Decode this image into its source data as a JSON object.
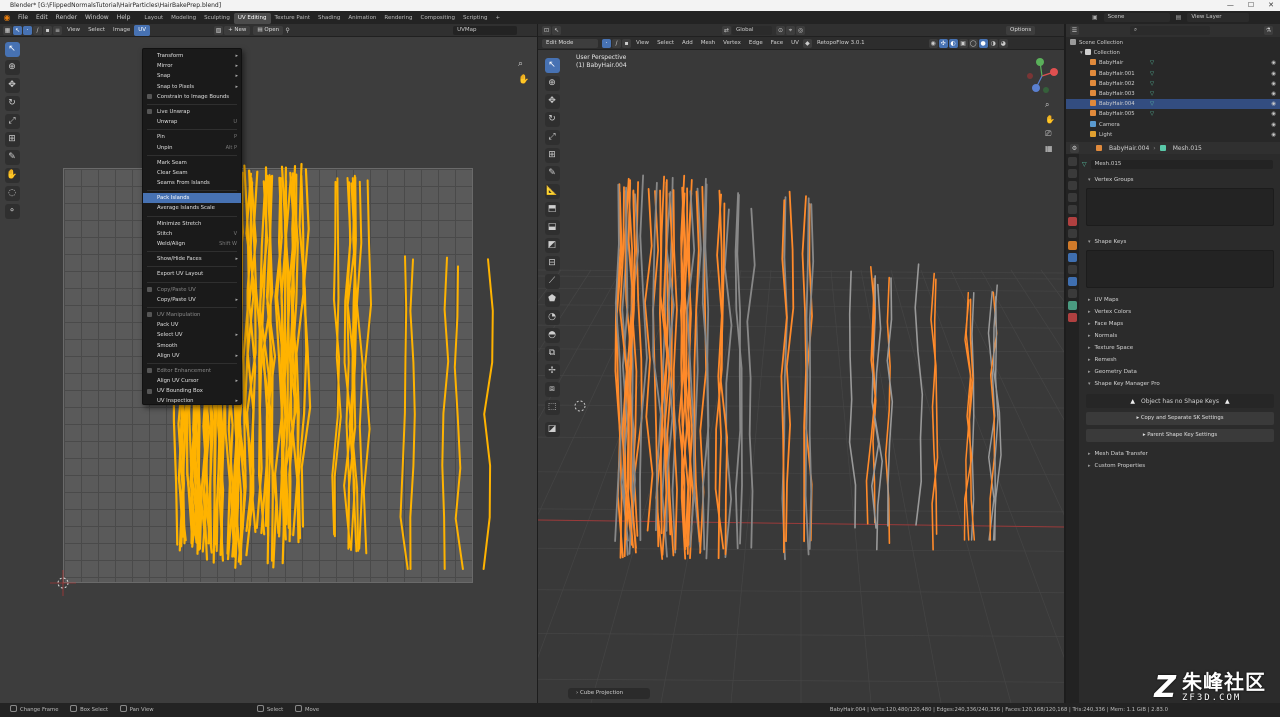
{
  "window": {
    "title": "Blender* [G:\\FlippedNormalsTutorial\\HairParticles\\HairBakePrep.blend]",
    "controls": [
      "—",
      "☐",
      "✕"
    ]
  },
  "topbar": {
    "menus": [
      "File",
      "Edit",
      "Render",
      "Window",
      "Help"
    ],
    "workspaces": [
      "Layout",
      "Modeling",
      "Sculpting",
      "UV Editing",
      "Texture Paint",
      "Shading",
      "Animation",
      "Rendering",
      "Compositing",
      "Scripting"
    ],
    "active_workspace": "UV Editing",
    "add_tab": "+",
    "scene_label": "Scene",
    "view_layer_label": "View Layer"
  },
  "uv_editor": {
    "header_menus": [
      "View",
      "Select",
      "Image",
      "UV"
    ],
    "new_label": "New",
    "open_label": "Open",
    "uvmap_field": "UVMap",
    "uv_color": "#ffb300"
  },
  "uv_menu": {
    "items": [
      {
        "label": "Transform",
        "submenu": true
      },
      {
        "label": "Mirror",
        "submenu": true
      },
      {
        "label": "Snap",
        "submenu": true
      },
      {
        "label": "Snap to Pixels",
        "submenu": true
      },
      {
        "label": "Constrain to Image Bounds",
        "check": true
      },
      {
        "sep": true
      },
      {
        "label": "Live Unwrap",
        "check": true
      },
      {
        "label": "Unwrap",
        "shortcut": "U"
      },
      {
        "sep": true
      },
      {
        "label": "Pin",
        "shortcut": "P"
      },
      {
        "label": "Unpin",
        "shortcut": "Alt P"
      },
      {
        "sep": true
      },
      {
        "label": "Mark Seam"
      },
      {
        "label": "Clear Seam"
      },
      {
        "label": "Seams From Islands"
      },
      {
        "sep": true
      },
      {
        "label": "Pack Islands",
        "highlight": true
      },
      {
        "label": "Average Islands Scale"
      },
      {
        "sep": true
      },
      {
        "label": "Minimize Stretch"
      },
      {
        "label": "Stitch",
        "shortcut": "V"
      },
      {
        "label": "Weld/Align",
        "shortcut": "Shift W"
      },
      {
        "sep": true
      },
      {
        "label": "Show/Hide Faces",
        "submenu": true
      },
      {
        "sep": true
      },
      {
        "label": "Export UV Layout"
      },
      {
        "sep": true
      },
      {
        "label": "Copy/Paste UV",
        "dim": true,
        "icon": true
      },
      {
        "label": "Copy/Paste UV",
        "submenu": true
      },
      {
        "sep": true
      },
      {
        "label": "UV Manipulation",
        "dim": true,
        "icon": true
      },
      {
        "label": "Pack UV"
      },
      {
        "label": "Select UV",
        "submenu": true
      },
      {
        "label": "Smooth"
      },
      {
        "label": "Align UV",
        "submenu": true
      },
      {
        "sep": true
      },
      {
        "label": "Editor Enhancement",
        "dim": true,
        "icon": true
      },
      {
        "label": "Align UV Cursor",
        "submenu": true
      },
      {
        "label": "UV Bounding Box",
        "check": true
      },
      {
        "label": "UV Inspection",
        "submenu": true
      }
    ]
  },
  "viewport": {
    "mode": "Edit Mode",
    "header_menus": [
      "View",
      "Select",
      "Add",
      "Mesh",
      "Vertex",
      "Edge",
      "Face",
      "UV"
    ],
    "addon": "RetopoFlow 3.0.1",
    "orientation": "Global",
    "options_label": "Options",
    "perspective_label": "User Perspective",
    "object_label": "(1) BabyHair.004",
    "operator_panel": "Cube Projection",
    "hair_color": "#ff8a2a"
  },
  "outliner": {
    "root": "Scene Collection",
    "collection": "Collection",
    "items": [
      {
        "name": "BabyHair",
        "selected": false
      },
      {
        "name": "BabyHair.001",
        "selected": false
      },
      {
        "name": "BabyHair.002",
        "selected": false
      },
      {
        "name": "BabyHair.003",
        "selected": false
      },
      {
        "name": "BabyHair.004",
        "selected": true
      },
      {
        "name": "BabyHair.005",
        "selected": false
      },
      {
        "name": "Camera",
        "selected": false
      },
      {
        "name": "Light",
        "selected": false
      }
    ]
  },
  "properties": {
    "breadcrumb_object": "BabyHair.004",
    "breadcrumb_mesh": "Mesh.015",
    "mesh_name": "Mesh.015",
    "panels_top": [
      "Vertex Groups",
      "Shape Keys"
    ],
    "panels": [
      "UV Maps",
      "Vertex Colors",
      "Face Maps",
      "Normals",
      "Texture Space",
      "Remesh",
      "Geometry Data",
      "Shape Key Manager Pro"
    ],
    "shape_key_warning": "Object has no Shape Keys",
    "copy_separate_btn": "Copy and Separate SK Settings",
    "parent_shape_btn": "Parent Shape Key Settings",
    "panels_bottom": [
      "Mesh Data Transfer",
      "Custom Properties"
    ]
  },
  "statusbar": {
    "left": [
      {
        "label": "Change Frame"
      },
      {
        "label": "Box Select"
      },
      {
        "label": "Pan View"
      }
    ],
    "middle": [
      {
        "label": "Select"
      },
      {
        "label": "Move"
      }
    ],
    "stats": "BabyHair.004 | Verts:120,480/120,480 | Edges:240,336/240,336 | Faces:120,168/120,168 | Tris:240,336 | Mem: 1.1 GiB | 2.83.0"
  },
  "watermark": {
    "brand_cn": "朱峰社区",
    "url": "ZF3D.COM",
    "logo": "Z"
  }
}
